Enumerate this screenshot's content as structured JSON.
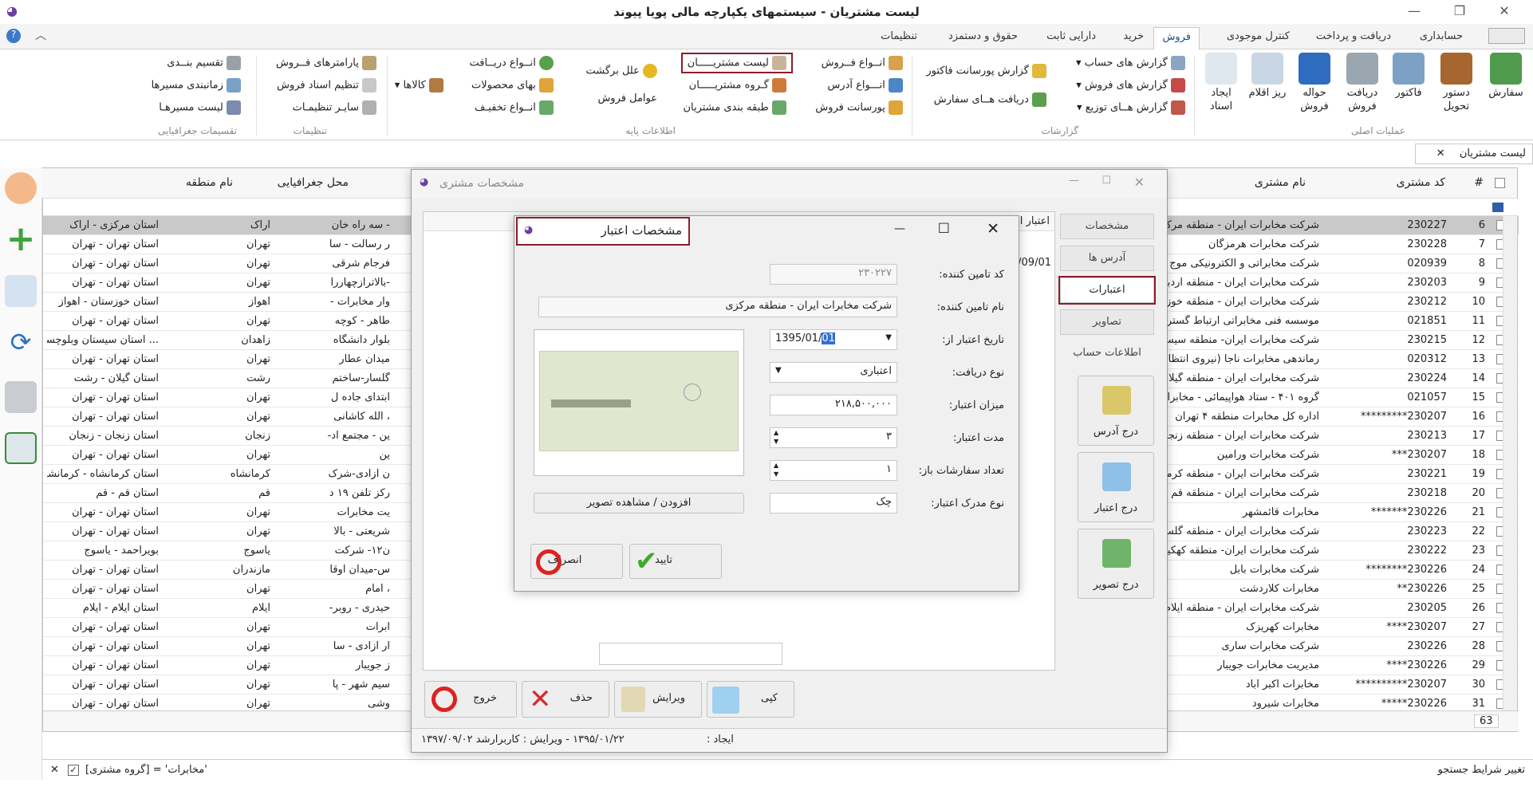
{
  "window": {
    "title": "لیست مشتریان - سیستمهای یکپارچه مالی پویا پیوند"
  },
  "tabs": [
    "حسابداری",
    "دریافت و پرداخت",
    "کنترل موجودی",
    "فروش",
    "خرید",
    "دارایی ثابت",
    "حقوق و دستمزد",
    "تنظیمات"
  ],
  "ribbon": {
    "main_ops": [
      "سفارش",
      "دستور تحویل",
      "فاکتور",
      "دریافت فروش",
      "حواله فروش",
      "ریز اقلام",
      "ایجاد اسناد"
    ],
    "main_ops_group": "عملیات اصلی",
    "reports": [
      "گزارش های حساب",
      "گزارش های فروش",
      "گزارش هــای توزیع",
      "گزارش پورسانت فاکتور",
      "دریافت هــای سفارش"
    ],
    "reports_group": "گزارشات",
    "base": [
      "انــواع فــروش",
      "انـــواع آدرس",
      "پورسانت فروش",
      "لیست مشتریـــــان",
      "گـروه مشتریـــــان",
      "طبقه بندی مشتریان",
      "علل برگشت",
      "عوامل فروش",
      "انــواع دریــافت",
      "بهای محصولات",
      "انــواع تخفیـف",
      "کالاها"
    ],
    "base_group": "اطلاعات پایه",
    "settings": [
      "پارامترهای فــروش",
      "تنظیم اسناد فروش",
      "سایـر تنظیمـات"
    ],
    "settings_group": "تنظیمات",
    "geo": [
      "تقسیم بنــدی",
      "زمانبندی مسیرها",
      "لیست مسیرهـا"
    ],
    "geo_group": "تقسیمات جغرافیایی"
  },
  "doc_tab": "لیست مشتریان",
  "grid": {
    "headers": {
      "num": "#",
      "code": "کد مشتری",
      "name": "نام مشتری",
      "place": "محل جغرافیایی",
      "region": "نام منطقه"
    },
    "rows": [
      {
        "n": "6",
        "code": "230227",
        "name": "شرکت مخابرات ایران - منطقه مرکزی",
        "addr": "- سه راه خان",
        "place": "اراک",
        "region": "استان مرکزی - اراک"
      },
      {
        "n": "7",
        "code": "230228",
        "name": "شرکت مخابرات هرمزگان",
        "addr": "ر رسالت - سا",
        "place": "تهران",
        "region": "استان تهران - تهران"
      },
      {
        "n": "8",
        "code": "020939",
        "name": "شرکت مخابراتی و الکترونیکی موج",
        "addr": "فرجام شرقی",
        "place": "تهران",
        "region": "استان تهران - تهران"
      },
      {
        "n": "9",
        "code": "230203",
        "name": "شرکت مخابرات ایران - منطقه اردبیل",
        "addr": "-بالاترازچهاررا",
        "place": "تهران",
        "region": "استان تهران - تهران"
      },
      {
        "n": "10",
        "code": "230212",
        "name": "شرکت مخابرات ایران - منطقه خوزستان",
        "addr": "وار مخابرات -",
        "place": "اهواز",
        "region": "استان خوزستان - اهواز"
      },
      {
        "n": "11",
        "code": "021851",
        "name": "موسسه فنی مخابراتی ارتباط گستر",
        "addr": "طاهر - کوچه",
        "place": "تهران",
        "region": "استان تهران - تهران"
      },
      {
        "n": "12",
        "code": "230215",
        "name": "شرکت مخابرات ایران- منطقه سیستان",
        "addr": "بلوار دانشگاه",
        "place": "زاهدان",
        "region": "... استان سیستان وبلوچستان"
      },
      {
        "n": "13",
        "code": "020312",
        "name": "رماندهی مخابرات ناجا (نیروی انتظامی",
        "addr": "میدان عطار",
        "place": "تهران",
        "region": "استان تهران - تهران"
      },
      {
        "n": "14",
        "code": "230224",
        "name": "شرکت مخابرات ایران - منطقه گیلان",
        "addr": "گلسار-ساختم",
        "place": "رشت",
        "region": "استان گیلان - رشت"
      },
      {
        "n": "15",
        "code": "021057",
        "name": "گروه ۴۰۱ - ستاد هواپیمائی - مخابرات",
        "addr": "ابتدای جاده ل",
        "place": "تهران",
        "region": "استان تهران - تهران"
      },
      {
        "n": "16",
        "code": "230207*********",
        "name": "اداره کل مخابرات منطقه ۴ تهران",
        "addr": "، الله کاشانی",
        "place": "تهران",
        "region": "استان تهران - تهران"
      },
      {
        "n": "17",
        "code": "230213",
        "name": "شرکت مخابرات ایران - منطقه زنجان",
        "addr": "ین - مجتمع اد-",
        "place": "زنجان",
        "region": "استان زنجان - زنجان"
      },
      {
        "n": "18",
        "code": "230207***",
        "name": "شرکت مخابرات ورامین",
        "addr": "ین",
        "place": "تهران",
        "region": "استان تهران - تهران"
      },
      {
        "n": "19",
        "code": "230221",
        "name": "شرکت مخابرات ایران - منطقه کرمانشاه",
        "addr": "ن آزادی-شرک",
        "place": "کرمانشاه",
        "region": "استان کرمانشاه - کرمانشاه"
      },
      {
        "n": "20",
        "code": "230218",
        "name": "شرکت مخابرات ایران - منطقه قم",
        "addr": "ِرکز تلفن ۱۹ د",
        "place": "قم",
        "region": "استان قم - قم"
      },
      {
        "n": "21",
        "code": "230226*******",
        "name": "مخابرات قائمشهر",
        "addr": "یت مخابرات",
        "place": "تهران",
        "region": "استان تهران - تهران"
      },
      {
        "n": "22",
        "code": "230223",
        "name": "شرکت مخابرات ایران - منطقه گلستان",
        "addr": "شریعتی - بالا",
        "place": "تهران",
        "region": "استان تهران - تهران"
      },
      {
        "n": "23",
        "code": "230222",
        "name": "شرکت مخابرات ایران- منطقه کهکیلویه",
        "addr": "ن۱۲- شرکت",
        "place": "یاسوج",
        "region": "بویراحمد - یاسوج"
      },
      {
        "n": "24",
        "code": "230226********",
        "name": "شرکت مخابرات بابل",
        "addr": "س-میدان اوقا",
        "place": "مازندران",
        "region": "استان تهران - تهران"
      },
      {
        "n": "25",
        "code": "230226**",
        "name": "مخابرات کلاردشت",
        "addr": "، امام",
        "place": "تهران",
        "region": "استان تهران - تهران"
      },
      {
        "n": "26",
        "code": "230205",
        "name": "شرکت مخابرات ایران - منطقه ایلام",
        "addr": "حیدری - روبر-",
        "place": "ایلام",
        "region": "استان ایلام - ایلام"
      },
      {
        "n": "27",
        "code": "230207****",
        "name": "مخابرات کهریزک",
        "addr": "ابرات",
        "place": "تهران",
        "region": "استان تهران - تهران"
      },
      {
        "n": "28",
        "code": "230226",
        "name": "شرکت مخابرات ساری",
        "addr": "ار آزادی - سا",
        "place": "تهران",
        "region": "استان تهران - تهران"
      },
      {
        "n": "29",
        "code": "230226****",
        "name": "مدیریت مخابرات جویبار",
        "addr": "ز جویبار",
        "place": "تهران",
        "region": "استان تهران - تهران"
      },
      {
        "n": "30",
        "code": "230207**********",
        "name": "مخابرات اکبر آباد",
        "addr": "سیم شهر - پا",
        "place": "تهران",
        "region": "استان تهران - تهران"
      },
      {
        "n": "31",
        "code": "230226*****",
        "name": "مخابرات شیرود",
        "addr": "وشی",
        "place": "تهران",
        "region": "استان تهران - تهران"
      }
    ],
    "count": "63",
    "filter_label": "تغییر شرایط جستجو",
    "filter_expr": "[گروه مشتری] = 'مخابرات'"
  },
  "customer_window": {
    "title": "مشخصات مشتری",
    "vtabs": [
      "مشخصات",
      "آدرس ها",
      "اعتبارات",
      "تصاویر",
      "اطلاعات حساب"
    ],
    "side_buttons": [
      "درج آدرس",
      "درج اعتبار",
      "درج تصویر"
    ],
    "col_header": "اعتبار از",
    "date_partial": "/09/01",
    "actions": [
      "کپی",
      "ویرایش",
      "حذف",
      "خروج"
    ],
    "status_create": "ایجاد :",
    "status_edit": "۱۳۹۵/۰۱/۲۲ - ویرایش : کاربرارشد ۱۳۹۷/۰۹/۰۲"
  },
  "credit_dialog": {
    "title": "مشخصات اعتبار",
    "supplier_code_label": "کد تامین کننده:",
    "supplier_code": "۲۳۰۲۲۷",
    "supplier_name_label": "نام تامین کننده:",
    "supplier_name": "شرکت مخابرات ایران - منطقه مرکزی",
    "credit_from_label": "تاریخ اعتبار از:",
    "credit_from": "1395/01/",
    "credit_from_sel": "01",
    "receive_type_label": "نوع دریافت:",
    "receive_type": "اعتباری",
    "amount_label": "میزان اعتبار:",
    "amount": "۲۱۸,۵۰۰,۰۰۰",
    "duration_label": "مدت اعتبار:",
    "duration": "۳",
    "open_orders_label": "تعداد سفارشات باز:",
    "open_orders": "۱",
    "doc_type_label": "نوع مدرک اعتبار:",
    "doc_type": "چک",
    "add_image": "افزودن / مشاهده تصویر",
    "confirm": "تایید",
    "cancel": "انصراف"
  },
  "colors": {
    "accent_red": "#8e1b2b",
    "selected_row": "#c9c9c9",
    "ribbon_active": "#1a4f8a"
  }
}
